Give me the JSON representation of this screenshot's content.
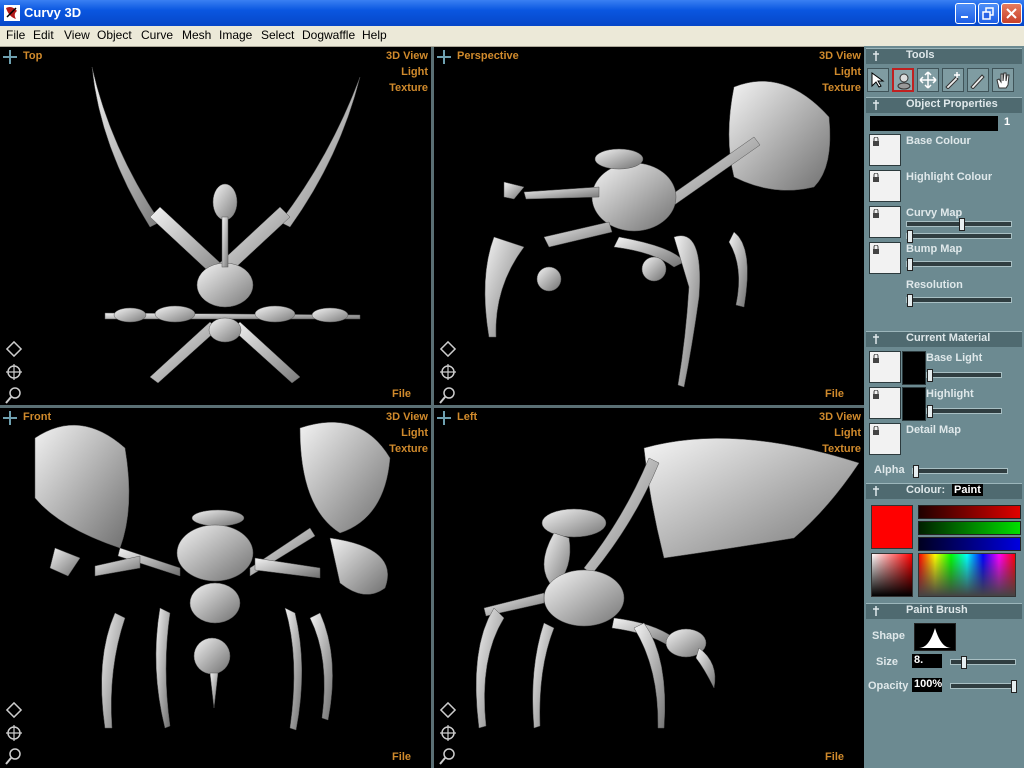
{
  "window": {
    "title": "Curvy 3D"
  },
  "menu": [
    "File",
    "Edit",
    "View",
    "Object",
    "Curve",
    "Mesh",
    "Image",
    "Select",
    "Dogwaffle",
    "Help"
  ],
  "viewports": [
    {
      "title": "Top",
      "menu": [
        "3D View",
        "Light",
        "Texture"
      ],
      "file": "File"
    },
    {
      "title": "Perspective",
      "menu": [
        "3D View",
        "Light",
        "Texture"
      ],
      "file": "File"
    },
    {
      "title": "Front",
      "menu": [
        "3D View",
        "Light",
        "Texture"
      ],
      "file": "File"
    },
    {
      "title": "Left",
      "menu": [
        "3D View",
        "Light",
        "Texture"
      ],
      "file": "File"
    }
  ],
  "panel": {
    "tools": {
      "title": "Tools",
      "items": [
        "arrow-icon",
        "sculpt-icon",
        "move-icon",
        "add-pen-icon",
        "pen-icon",
        "hand-icon"
      ]
    },
    "object_properties": {
      "title": "Object Properties",
      "index": "1",
      "labels": {
        "base_colour": "Base Colour",
        "highlight_colour": "Highlight Colour",
        "curvy_map": "Curvy Map",
        "bump_map": "Bump Map",
        "resolution": "Resolution"
      }
    },
    "current_material": {
      "title": "Current Material",
      "labels": {
        "base_light": "Base Light",
        "highlight": "Highlight",
        "detail_map": "Detail Map",
        "alpha": "Alpha"
      }
    },
    "colour": {
      "title": "Colour:",
      "mode": "Paint",
      "current": "#ff0000"
    },
    "paint_brush": {
      "title": "Paint Brush",
      "shape_label": "Shape",
      "size_label": "Size",
      "size_value": "8.",
      "opacity_label": "Opacity",
      "opacity_value": "100%"
    }
  }
}
